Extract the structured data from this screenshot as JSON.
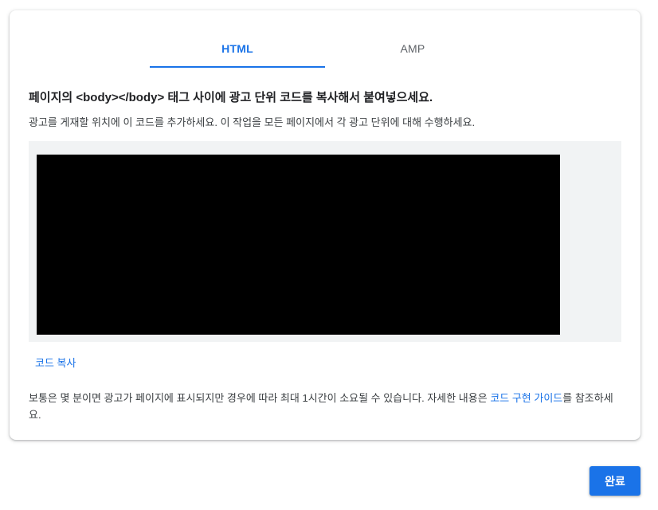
{
  "tabs": [
    {
      "label": "HTML",
      "active": true
    },
    {
      "label": "AMP",
      "active": false
    }
  ],
  "instructions": {
    "heading": "페이지의 <body></body> 태그 사이에 광고 단위 코드를 복사해서 붙여넣으세요.",
    "subtext": "광고를 게재할 위치에 이 코드를 추가하세요. 이 작업을 모든 페이지에서 각 광고 단위에 대해 수행하세요."
  },
  "copy_code_label": "코드 복사",
  "note": {
    "text_before": "보통은 몇 분이면 광고가 페이지에 표시되지만 경우에 따라 최대 1시간이 소요될 수 있습니다. 자세한 내용은 ",
    "link_text": "코드 구현 가이드",
    "text_after": "를 참조하세요."
  },
  "done_button_label": "완료",
  "colors": {
    "accent": "#1a73e8",
    "code_background": "#000000",
    "code_area_background": "#f1f3f4"
  }
}
